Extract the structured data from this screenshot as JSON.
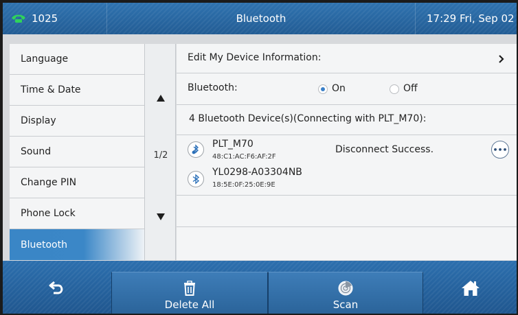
{
  "status_bar": {
    "account": "1025",
    "title": "Bluetooth",
    "clock": "17:29 Fri, Sep 02"
  },
  "sidebar": {
    "items": [
      {
        "label": "Language",
        "active": false
      },
      {
        "label": "Time & Date",
        "active": false
      },
      {
        "label": "Display",
        "active": false
      },
      {
        "label": "Sound",
        "active": false
      },
      {
        "label": "Change PIN",
        "active": false
      },
      {
        "label": "Phone Lock",
        "active": false
      },
      {
        "label": "Bluetooth",
        "active": true
      }
    ]
  },
  "pager": {
    "page": "1/2",
    "up_icon": "triangle-up-icon",
    "down_icon": "triangle-down-icon"
  },
  "main": {
    "edit_device_info": {
      "label": "Edit My Device Information:",
      "icon": "chevron-right-icon"
    },
    "bluetooth": {
      "label": "Bluetooth:",
      "options": [
        "On",
        "Off"
      ],
      "selected": "On"
    },
    "devices_header": "4 Bluetooth Device(s)(Connecting with PLT_M70):",
    "devices": [
      {
        "name": "PLT_M70",
        "mac": "48:C1:AC:F6:AF:2F",
        "status": "Disconnect Success.",
        "icon": "bluetooth-headset-icon",
        "more_icon": "more-options-icon"
      },
      {
        "name": "YL0298-A03304NB",
        "mac": "18:5E:0F:25:0E:9E",
        "status": "",
        "icon": "bluetooth-icon"
      }
    ]
  },
  "softkeys": {
    "back": {
      "icon": "back-arrow-icon"
    },
    "delete_all": {
      "label": "Delete All",
      "icon": "trash-icon"
    },
    "scan": {
      "label": "Scan",
      "icon": "radar-icon"
    },
    "home": {
      "icon": "home-icon"
    }
  },
  "colors": {
    "bar_blue": "#2a6aa6",
    "active_item": "#3a86c6",
    "panel_bg": "#f4f5f6"
  }
}
